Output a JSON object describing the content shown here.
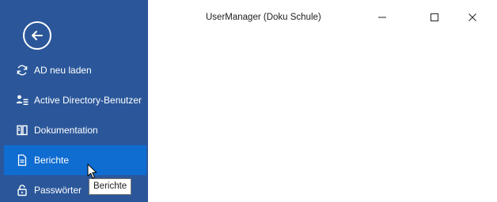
{
  "window": {
    "title": "UserManager (Doku Schule)"
  },
  "colors": {
    "sidebar_bg": "#2b579a",
    "active_item_bg": "#0f6cd1"
  },
  "sidebar": {
    "back_icon": "back-arrow-icon",
    "items": [
      {
        "label": "AD neu laden",
        "icon": "refresh-icon",
        "active": false
      },
      {
        "label": "Active Directory-Benutzer",
        "icon": "users-icon",
        "active": false
      },
      {
        "label": "Dokumentation",
        "icon": "book-icon",
        "active": false
      },
      {
        "label": "Berichte",
        "icon": "document-icon",
        "active": true
      },
      {
        "label": "Passwörter",
        "icon": "lock-icon",
        "active": false
      }
    ]
  },
  "tooltip": {
    "text": "Berichte"
  }
}
